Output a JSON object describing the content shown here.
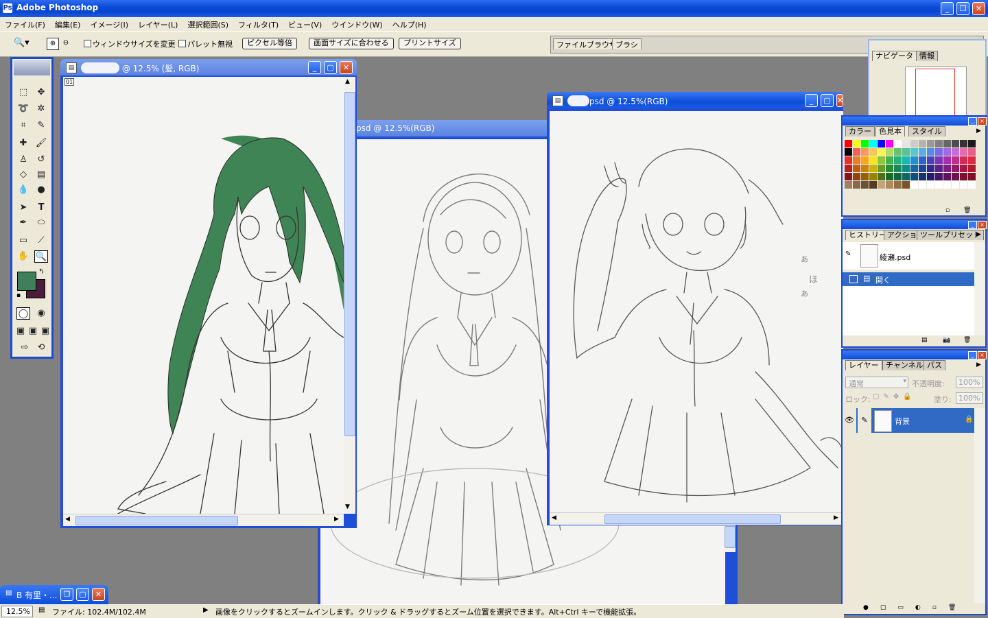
{
  "app": {
    "title": "Adobe Photoshop",
    "logo_icon": "photoshop-logo-icon"
  },
  "menu": [
    "ファイル(F)",
    "編集(E)",
    "イメージ(I)",
    "レイヤー(L)",
    "選択範囲(S)",
    "フィルタ(T)",
    "ビュー(V)",
    "ウインドウ(W)",
    "ヘルプ(H)"
  ],
  "options": {
    "resize_window_label": "ウィンドウサイズを変更",
    "ignore_palettes_label": "パレット無視",
    "actual_pixels_label": "ピクセル等倍",
    "fit_screen_label": "画面サイズに合わせる",
    "print_size_label": "プリントサイズ",
    "well_tabs": [
      "ファイルブラウザ",
      "ブラシ"
    ]
  },
  "windows": {
    "left": {
      "title_suffix": "@ 12.5% (髪, RGB)",
      "badge": "01"
    },
    "middle": {
      "title": "psd @ 12.5%(RGB)"
    },
    "right": {
      "title_suffix": "psd @ 12.5%(RGB)"
    }
  },
  "palettes": {
    "navigator": {
      "tabs": [
        "ナビゲータ",
        "情報"
      ]
    },
    "swatches": {
      "tabs": [
        "カラー",
        "色見本",
        "スタイル"
      ]
    },
    "history": {
      "tabs": [
        "ヒストリー",
        "アクション",
        "ツールプリセット"
      ],
      "snapshot": "綾瀬.psd",
      "step": "開く"
    },
    "layers": {
      "tabs": [
        "レイヤー",
        "チャンネル",
        "パス"
      ],
      "blend_mode": "通常",
      "opacity_label": "不透明度:",
      "opacity_value": "100%",
      "lock_label": "ロック:",
      "fill_label": "塗り:",
      "fill_value": "100%",
      "layer_name": "背景"
    }
  },
  "status": {
    "zoom": "12.5%",
    "file_info": "ファイル: 102.4M/102.4M",
    "hint": "画像をクリックするとズームインします。クリック & ドラッグするとズーム位置を選択できます。Alt+Ctrl キーで機能拡張。"
  },
  "minimized": {
    "title": "B 有里・..."
  },
  "colors": {
    "foreground": "#3f7f5a",
    "background": "#4a1d3a",
    "hair_fill": "#3e8454",
    "titlebar": "#0a4ad6",
    "selection": "#316ac5"
  }
}
